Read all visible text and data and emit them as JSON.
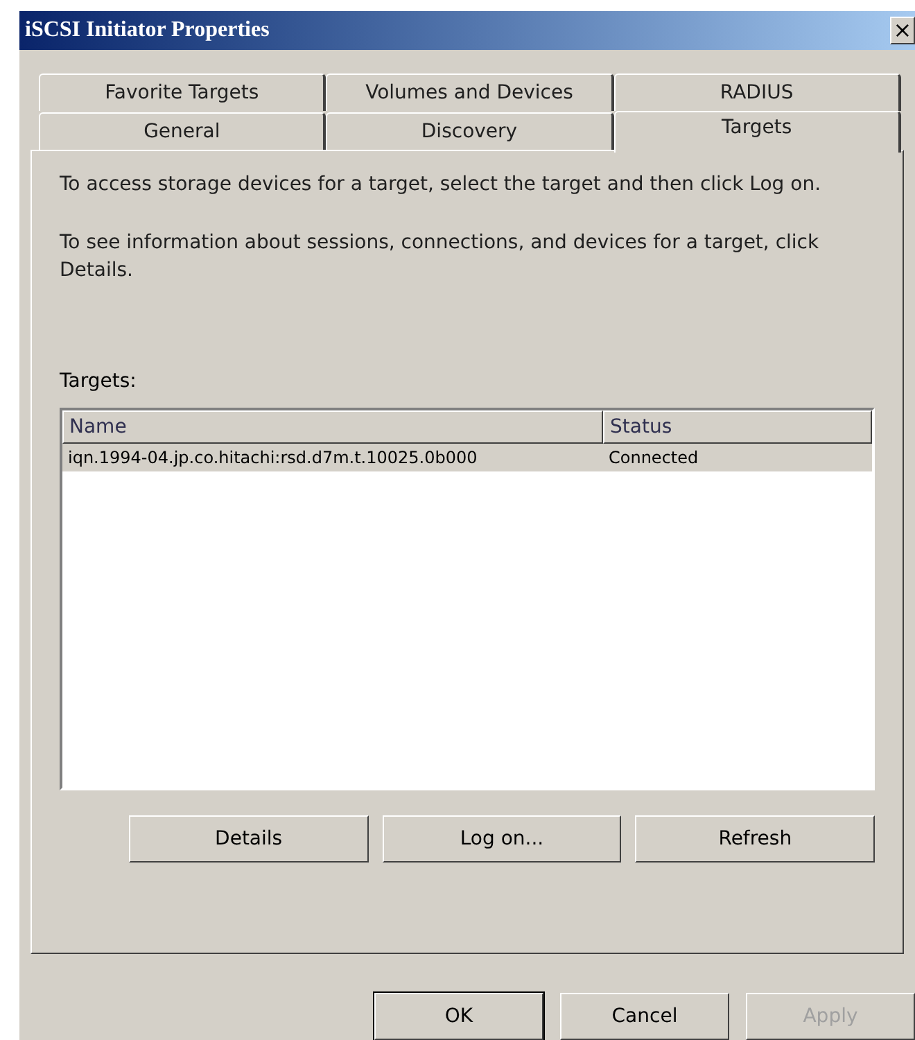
{
  "window": {
    "title": "iSCSI Initiator Properties",
    "close": "×"
  },
  "tab_rows": [
    [
      {
        "label": "Favorite Targets",
        "selected": false
      },
      {
        "label": "Volumes and Devices",
        "selected": false
      },
      {
        "label": "RADIUS",
        "selected": false
      }
    ],
    [
      {
        "label": "General",
        "selected": false
      },
      {
        "label": "Discovery",
        "selected": false
      },
      {
        "label": "Targets",
        "selected": true
      }
    ]
  ],
  "paragraphs": [
    "To access storage devices for a target, select the target and then click Log on.",
    "To see information about sessions, connections, and devices for a target, click Details."
  ],
  "targets": {
    "label": "Targets:",
    "columns": [
      "Name",
      "Status"
    ],
    "rows": [
      {
        "cells": [
          "iqn.1994-04.jp.co.hitachi:rsd.d7m.t.10025.0b000",
          "Connected"
        ],
        "selected": true
      }
    ]
  },
  "panel_buttons": [
    {
      "label": "Details",
      "disabled": false
    },
    {
      "label": "Log on...",
      "disabled": false
    },
    {
      "label": "Refresh",
      "disabled": false
    }
  ],
  "dialog_buttons": [
    {
      "label": "OK",
      "disabled": false,
      "default": true
    },
    {
      "label": "Cancel",
      "disabled": false,
      "default": false
    },
    {
      "label": "Apply",
      "disabled": true,
      "default": false
    }
  ]
}
